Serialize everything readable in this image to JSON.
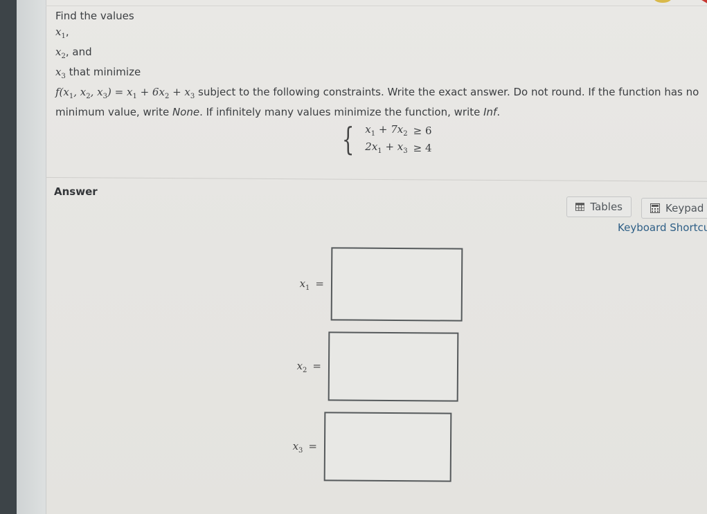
{
  "question": {
    "intro": "Find the values",
    "var1": "x",
    "var1_sub": "1",
    "var1_suffix": ",",
    "var2": "x",
    "var2_sub": "2",
    "var2_suffix": ", and",
    "var3": "x",
    "var3_sub": "3",
    "var3_suffix": " that minimize",
    "function_lhs": "f(x",
    "function_parts": {
      "a": "1",
      "b": ", x",
      "c": "2",
      "d": ", x",
      "e": "3",
      "f": ")",
      "eq": " = ",
      "t1": "x",
      "t1s": "1",
      "plus1": " + ",
      "t2": "6x",
      "t2s": "2",
      "plus2": " + ",
      "t3": "x",
      "t3s": "3"
    },
    "instruction_part1": " subject to the following constraints. Write the exact answer. Do not round. If the function has no",
    "instruction_part2": "minimum value, write ",
    "none_word": "None",
    "instruction_part3": ". If infinitely many values minimize the function, write ",
    "inf_word": "Inf",
    "instruction_end": "."
  },
  "constraints": [
    {
      "lhs_a": "x",
      "lhs_a_sub": "1",
      "op": " + 7x",
      "lhs_b_sub": "2",
      "rel": "≥",
      "rhs": "6"
    },
    {
      "lhs_a": "2x",
      "lhs_a_sub": "1",
      "op": " + x",
      "lhs_b_sub": "3",
      "rel": "≥",
      "rhs": "4"
    }
  ],
  "answer": {
    "label": "Answer",
    "tables_label": "Tables",
    "keypad_label": "Keypad",
    "keyboard_shortcuts": "Keyboard Shortcuts",
    "fields": [
      {
        "var": "x",
        "sub": "1",
        "eq": "=",
        "value": ""
      },
      {
        "var": "x",
        "sub": "2",
        "eq": "=",
        "value": ""
      },
      {
        "var": "x",
        "sub": "3",
        "eq": "=",
        "value": ""
      }
    ]
  },
  "colors": {
    "link": "#2e5f86",
    "text": "#3b3e41",
    "box_border": "#55595b"
  }
}
